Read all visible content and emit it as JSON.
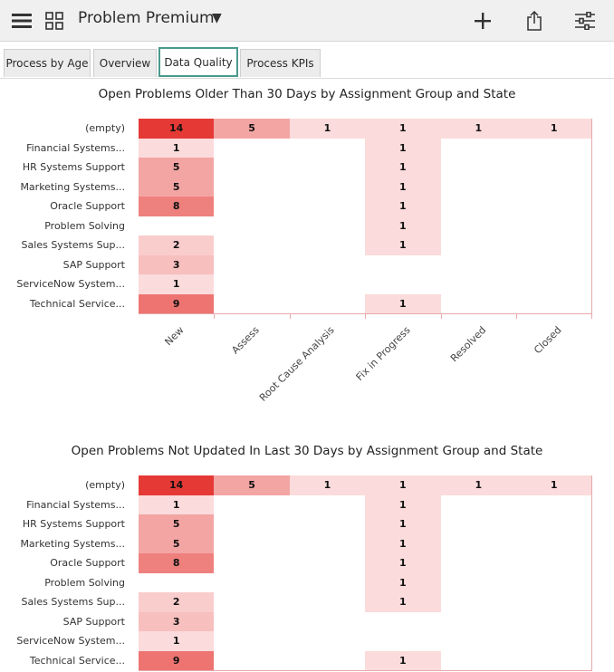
{
  "header": {
    "title": "Problem Premium",
    "menu_icon": "hamburger-menu-icon",
    "grid_icon": "dashboard-grid-icon",
    "caret_icon": "caret-down-icon",
    "add_icon": "plus-icon",
    "share_icon": "share-icon",
    "filter_icon": "sliders-icon"
  },
  "tabs": [
    {
      "label": "Process by Age",
      "active": false
    },
    {
      "label": "Overview",
      "active": false
    },
    {
      "label": "Data Quality",
      "active": true
    },
    {
      "label": "Process KPIs",
      "active": false
    }
  ],
  "colors": {
    "accent": "#4a9a8e",
    "heat_max": "#e53935",
    "heat_min": "#fdecec",
    "grid": "#e8a9a9"
  },
  "chart_data": [
    {
      "type": "heatmap",
      "title": "Open Problems Older Than 30 Days by Assignment Group and State",
      "rows": [
        "(empty)",
        "Financial Systems...",
        "HR Systems Support",
        "Marketing Systems...",
        "Oracle Support",
        "Problem Solving",
        "Sales Systems Sup...",
        "SAP Support",
        "ServiceNow System...",
        "Technical Service..."
      ],
      "columns": [
        "New",
        "Assess",
        "Root Cause Analysis",
        "Fix in Progress",
        "Resolved",
        "Closed"
      ],
      "values": [
        [
          14,
          5,
          1,
          1,
          1,
          1
        ],
        [
          1,
          null,
          null,
          1,
          null,
          null
        ],
        [
          5,
          null,
          null,
          1,
          null,
          null
        ],
        [
          5,
          null,
          null,
          1,
          null,
          null
        ],
        [
          8,
          null,
          null,
          1,
          null,
          null
        ],
        [
          null,
          null,
          null,
          1,
          null,
          null
        ],
        [
          2,
          null,
          null,
          1,
          null,
          null
        ],
        [
          3,
          null,
          null,
          null,
          null,
          null
        ],
        [
          1,
          null,
          null,
          null,
          null,
          null
        ],
        [
          9,
          null,
          null,
          1,
          null,
          null
        ]
      ]
    },
    {
      "type": "heatmap",
      "title": "Open Problems Not Updated In Last 30 Days by Assignment Group and State",
      "rows": [
        "(empty)",
        "Financial Systems...",
        "HR Systems Support",
        "Marketing Systems...",
        "Oracle Support",
        "Problem Solving",
        "Sales Systems Sup...",
        "SAP Support",
        "ServiceNow System...",
        "Technical Service..."
      ],
      "columns": [
        "New",
        "Assess",
        "Root Cause Analysis",
        "Fix in Progress",
        "Resolved",
        "Closed"
      ],
      "values": [
        [
          14,
          5,
          1,
          1,
          1,
          1
        ],
        [
          1,
          null,
          null,
          1,
          null,
          null
        ],
        [
          5,
          null,
          null,
          1,
          null,
          null
        ],
        [
          5,
          null,
          null,
          1,
          null,
          null
        ],
        [
          8,
          null,
          null,
          1,
          null,
          null
        ],
        [
          null,
          null,
          null,
          1,
          null,
          null
        ],
        [
          2,
          null,
          null,
          1,
          null,
          null
        ],
        [
          3,
          null,
          null,
          null,
          null,
          null
        ],
        [
          1,
          null,
          null,
          null,
          null,
          null
        ],
        [
          9,
          null,
          null,
          1,
          null,
          null
        ]
      ]
    }
  ]
}
